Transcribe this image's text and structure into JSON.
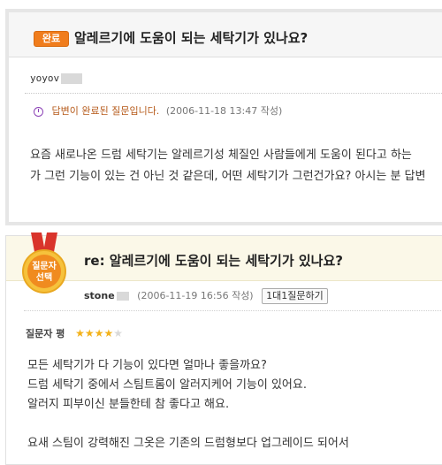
{
  "question": {
    "badge": "완료",
    "title": "알레르기에 도움이 되는 세탁기가 있나요?",
    "user": "yoyov",
    "status": "답변이 완료된 질문입니다.",
    "date": "(2006-11-18 13:47 작성)",
    "body": [
      "요즘 새로나온 드럼 세탁기는 알레르기성 체질인 사람들에게 도움이 된다고 하는",
      "가 그런 기능이 있는 건 아닌 것 같은데, 어떤 세탁기가 그런건가요? 아시는 분 답변"
    ]
  },
  "answer": {
    "medal_text": [
      "질문자",
      "선택"
    ],
    "title": "re: 알레르기에 도움이 되는 세탁기가 있나요?",
    "user": "stone",
    "date": "(2006-11-19 16:56 작성)",
    "one_on_one_label": "1대1질문하기",
    "rating_label": "질문자 평",
    "rating_stars": 4,
    "rating_max": 5,
    "body": [
      "모든 세탁기가 다 기능이 있다면 얼마나 좋을까요?",
      "드럼 세탁기 중에서 스팀트롬이 알러지케어 기능이 있어요.",
      "알러지 피부이신 분들한테 참 좋다고 해요.",
      "요새 스팀이 강력해진 그옷은 기존의 드럼형보다 업그레이드 되어서"
    ]
  },
  "colors": {
    "badge": "#f07d1d",
    "status_text": "#b65a1a",
    "star_on": "#f3b21b",
    "answer_header_bg": "#fbf8e8"
  }
}
